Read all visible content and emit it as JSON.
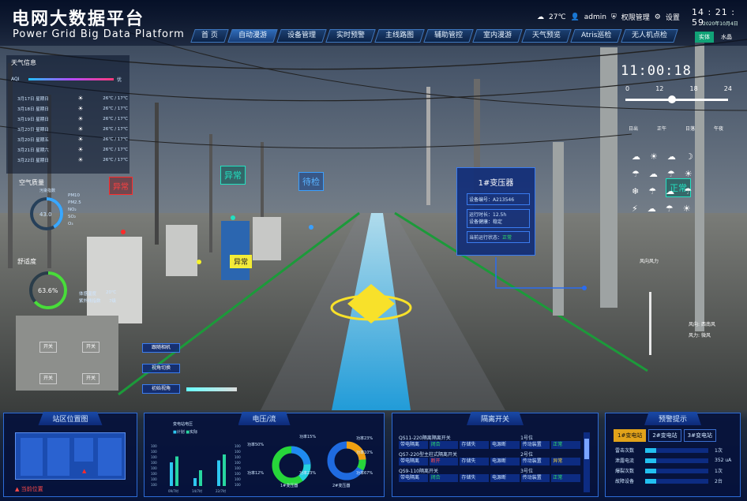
{
  "header": {
    "title_cn": "电网大数据平台",
    "title_en": "Power Grid Big Data Platform",
    "temperature": "27℃",
    "user": "admin",
    "permission": "权限管理",
    "settings": "设置",
    "clock": "14 : 21 : 59",
    "date": "2020年10月4日",
    "mode_button": "实体",
    "mode_label": "水晶"
  },
  "nav": [
    "首 页",
    "自动漫游",
    "设备管理",
    "实时预警",
    "主线路图",
    "辅助管控",
    "室内漫游",
    "天气预览",
    "Atris巡检",
    "无人机点检"
  ],
  "weather": {
    "title": "天气信息",
    "aqi_label": "AQI",
    "aqi_value_label": "优",
    "days": [
      {
        "date": "3月17日 星期日",
        "temp": "26℃ / 17℃"
      },
      {
        "date": "3月18日 星期日",
        "temp": "26℃ / 17℃"
      },
      {
        "date": "3月19日 星期日",
        "temp": "26℃ / 17℃"
      },
      {
        "date": "3月20日 星期日",
        "temp": "26℃ / 17℃"
      },
      {
        "date": "3月20日 星期五",
        "temp": "26℃ / 17℃"
      },
      {
        "date": "3月21日 星期六",
        "temp": "26℃ / 17℃"
      },
      {
        "date": "3月22日 星期日",
        "temp": "26℃ / 17℃"
      }
    ]
  },
  "air": {
    "title": "空气质量",
    "pollutant_label": "污染指数",
    "gauge_value": "43.0",
    "items": [
      "PM10",
      "PM2.5",
      "NO₂",
      "SO₂",
      "O₃"
    ]
  },
  "comfort": {
    "title": "舒适度",
    "value": "63.6%",
    "percent": 63.6,
    "body_temp": "体感温度",
    "body_temp_val": "20℃",
    "uv": "紫外线指数",
    "uv_val": "7级"
  },
  "scene_tags": {
    "tag_a": "异常",
    "tag_b": "待检",
    "tag_c": "异常",
    "tag_d": "正常",
    "tag_e": "异常"
  },
  "scene_clock": "11:00:18",
  "timeline": {
    "ticks": [
      "0",
      "12",
      "18",
      "24"
    ],
    "labels": [
      "日出",
      "正午",
      "日落",
      "午夜"
    ]
  },
  "wind": {
    "power_label": "风向风力",
    "direction_label": "风向:",
    "direction": "西南风",
    "force_label": "风力:",
    "force": "微风"
  },
  "transformer": {
    "title": "1#变压器",
    "device_label": "设备编号：",
    "device_no": "A213546",
    "runtime_label": "运行时长：",
    "runtime": "12.5h",
    "health_label": "设备健康：",
    "health": "稳定",
    "state_label": "当前运行状态：",
    "state": "正常"
  },
  "side_buttons": [
    "跟随相机",
    "视角切换",
    "初始视角"
  ],
  "switch_labels": [
    "开关",
    "开关",
    "开关",
    "开关"
  ],
  "station_panel": {
    "title": "站区位置图",
    "legend": "当前位置"
  },
  "voltage_panel": {
    "title": "电压/流",
    "bar_title": "变电站电压",
    "legend": [
      "计划",
      "实际"
    ],
    "x_labels": [
      "09/7时",
      "14/7时",
      "22/7时"
    ],
    "y_labels": [
      "100",
      "100",
      "100",
      "100",
      "100",
      "100",
      "100",
      "100"
    ],
    "donut1": {
      "label": "1#变压器",
      "p1": "功率15%",
      "p2": "功率50%",
      "p3": "功率12%",
      "p4": "功率23%"
    },
    "donut2": {
      "label": "2#变压器",
      "p1": "功率23%",
      "p2": "功率10%",
      "p3": "功率67%"
    }
  },
  "chart_data": {
    "type": "bar",
    "categories": [
      "09/7时",
      "14/7时",
      "22/7时"
    ],
    "series": [
      {
        "name": "计划",
        "values": [
          60,
          20,
          65
        ]
      },
      {
        "name": "实际",
        "values": [
          75,
          40,
          80
        ]
      }
    ]
  },
  "isolation_panel": {
    "title": "隔离开关",
    "rows": [
      {
        "name": "QS11-220隔离隔离开关",
        "status": "1号位",
        "cells": [
          "带电隔离",
          "闭合",
          "存储失",
          "电源断",
          "传动装置",
          "正常"
        ]
      },
      {
        "name": "QS7-220型主柱式隔离开关",
        "status": "2号位",
        "cells": [
          "带电隔离",
          "断开",
          "存储失",
          "电源断",
          "传动装置",
          "异常"
        ]
      },
      {
        "name": "QS9-110隔离开关",
        "status": "3号位",
        "cells": [
          "带电隔离",
          "闭合",
          "存储失",
          "电源断",
          "传动装置",
          "正常"
        ]
      }
    ]
  },
  "warning_panel": {
    "title": "预警提示",
    "tabs": [
      "1#变电站",
      "2#变电站",
      "3#变电站"
    ],
    "items": [
      {
        "label": "雷击次数",
        "value": "1次"
      },
      {
        "label": "泄露电流",
        "value": "352 uA"
      },
      {
        "label": "爆裂次数",
        "value": "1次"
      },
      {
        "label": "故障设备",
        "value": "2台"
      }
    ]
  }
}
